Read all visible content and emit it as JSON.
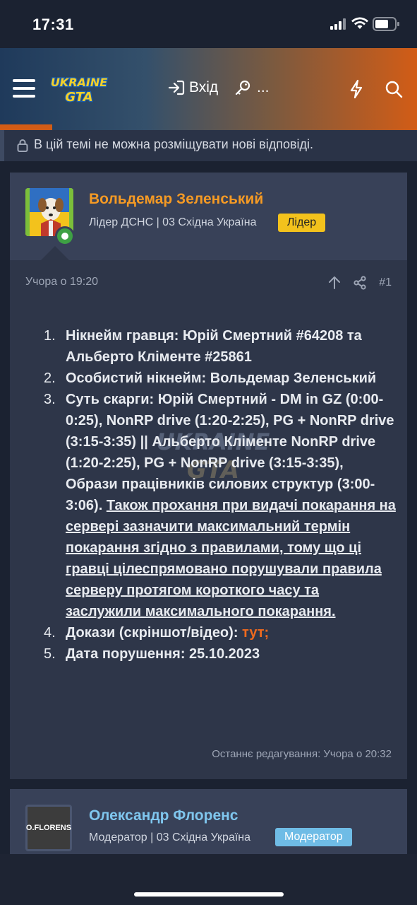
{
  "status_bar": {
    "time": "17:31"
  },
  "header": {
    "logo_line1": "UKRAINE",
    "logo_line2": "GTA",
    "login_label": "Вхід",
    "more_label": "..."
  },
  "notice": {
    "text": "В цій темі не можна розміщувати нові відповіді."
  },
  "post": {
    "author": "Вольдемар Зеленський",
    "role": "Лідер ДСНС | 03 Східна Україна",
    "badge": "Лідер",
    "date": "Учора о 19:20",
    "number": "#1",
    "items": [
      {
        "n": "1.",
        "text": "Нікнейм гравця: Юрій Смертний #64208 та Альберто Кліменте #25861"
      },
      {
        "n": "2.",
        "text": "Особистий нікнейм: Вольдемар Зеленський"
      },
      {
        "n": "3.",
        "text": "Суть скарги: Юрій Смертний - DM in GZ (0:00-0:25), NonRP drive (1:20-2:25), PG + NonRP drive (3:15-3:35) || Альберто Кліменте NonRP drive (1:20-2:25), PG + NonRP drive (3:15-3:35), Образи працівників силових структур (3:00-3:06).",
        "underline": "Також прохання при видачі покарання на сервері зазначити максимальний термін покарання згідно з правилами, тому що ці гравці цілеспрямовано порушували правила серверу протягом короткого часу та заслужили максимального покарання."
      },
      {
        "n": "4.",
        "text": "Докази (скріншот/відео):",
        "link": "тут;"
      },
      {
        "n": "5.",
        "text": "Дата порушення: 25.10.2023"
      }
    ],
    "edited": "Останнє редагування: Учора о 20:32"
  },
  "post2": {
    "author": "Олександр Флоренс",
    "role": "Модератор | 03 Східна Україна",
    "badge": "Модератор",
    "avatar_text": "O.FLORENS"
  },
  "colors": {
    "accent": "#d25c16",
    "leader_badge": "#f3c21c",
    "mod_badge": "#6fbce6",
    "author_orange": "#f59a24",
    "author_blue": "#7fc6ee"
  }
}
